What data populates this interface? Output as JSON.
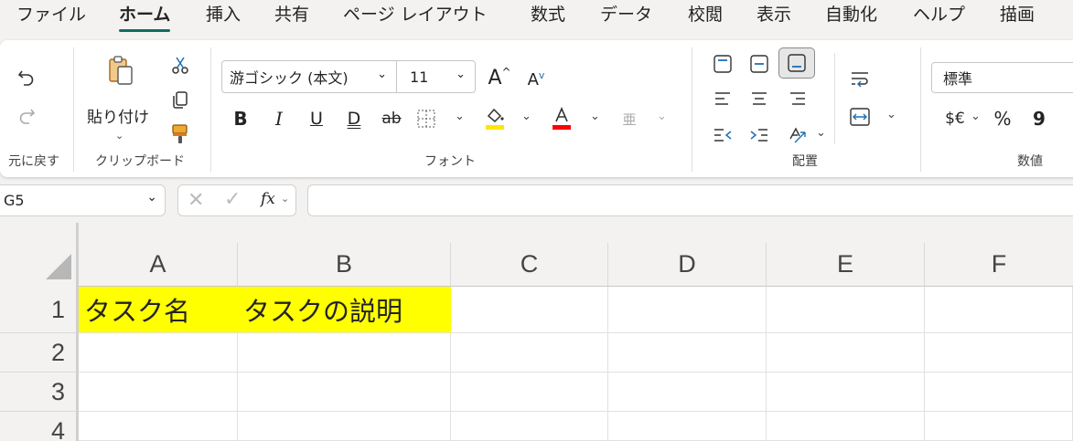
{
  "tabs": [
    {
      "label": "ファイル",
      "active": false
    },
    {
      "label": "ホーム",
      "active": true
    },
    {
      "label": "挿入",
      "active": false
    },
    {
      "label": "共有",
      "active": false
    },
    {
      "label": "ページ レイアウト",
      "active": false
    },
    {
      "label": "数式",
      "active": false
    },
    {
      "label": "データ",
      "active": false
    },
    {
      "label": "校閲",
      "active": false
    },
    {
      "label": "表示",
      "active": false
    },
    {
      "label": "自動化",
      "active": false
    },
    {
      "label": "ヘルプ",
      "active": false
    },
    {
      "label": "描画",
      "active": false
    }
  ],
  "ribbon": {
    "undo_group_label": "元に戻す",
    "clipboard": {
      "paste_label": "貼り付け",
      "group_label": "クリップボード"
    },
    "font": {
      "name": "游ゴシック (本文)",
      "size": "11",
      "group_label": "フォント",
      "bold": "B",
      "italic": "I",
      "underline": "U",
      "double_underline": "D",
      "strike": "ab",
      "phonetic": "亜"
    },
    "alignment": {
      "group_label": "配置"
    },
    "number": {
      "format": "標準",
      "group_label": "数値",
      "currency": "$€",
      "percent": "%",
      "comma": "9"
    }
  },
  "colors": {
    "accent": "#0f6e5f",
    "fill_yellow": "#ffff00",
    "font_red": "#ff0000",
    "highlight_yellow": "#ffe600"
  },
  "formula_bar": {
    "name_box": "G5",
    "fx_label": "fx",
    "formula": ""
  },
  "grid": {
    "columns": [
      "A",
      "B",
      "C",
      "D",
      "E",
      "F"
    ],
    "rows": [
      "1",
      "2",
      "3",
      "4"
    ],
    "cells": {
      "A1": "タスク名",
      "B1": "タスクの説明"
    }
  }
}
